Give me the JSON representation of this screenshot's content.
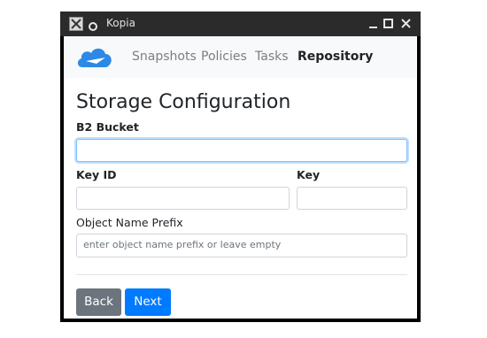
{
  "window": {
    "title": "Kopia",
    "app_icon": "x-app-icon",
    "pin_icon": "pin-icon",
    "controls": [
      "minimize-icon",
      "maximize-icon",
      "close-icon"
    ]
  },
  "nav": {
    "logo": "kopia-logo",
    "items": [
      {
        "label": "Snapshots",
        "active": false
      },
      {
        "label": "Policies",
        "active": false
      },
      {
        "label": "Tasks",
        "active": false
      },
      {
        "label": "Repository",
        "active": true
      }
    ]
  },
  "page": {
    "heading": "Storage Configuration"
  },
  "form": {
    "bucket": {
      "label": "B2 Bucket",
      "value": "",
      "placeholder": ""
    },
    "key_id": {
      "label": "Key ID",
      "value": "",
      "placeholder": ""
    },
    "key": {
      "label": "Key",
      "value": "",
      "placeholder": ""
    },
    "prefix": {
      "label": "Object Name Prefix",
      "value": "",
      "placeholder": "enter object name prefix or leave empty"
    }
  },
  "buttons": {
    "back": "Back",
    "next": "Next"
  },
  "colors": {
    "primary": "#007bff",
    "secondary": "#6c757d",
    "navbar_bg": "#f8f9fa",
    "titlebar_bg": "#2b2b2b"
  }
}
